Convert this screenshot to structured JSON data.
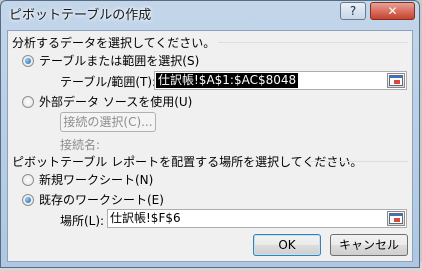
{
  "window": {
    "title": "ピボットテーブルの作成",
    "help_label": "?",
    "close_label": "✕"
  },
  "source_section": {
    "heading": "分析するデータを選択してください。",
    "option_table": {
      "label": "テーブルまたは範囲を選択(S)",
      "checked": true
    },
    "table_range": {
      "label": "テーブル/範囲(T):",
      "value": "仕訳帳!$A$1:$AC$8048"
    },
    "option_external": {
      "label": "外部データ ソースを使用(U)",
      "checked": false
    },
    "choose_connection_label": "接続の選択(C)...",
    "connection_name_label": "接続名:"
  },
  "location_section": {
    "heading": "ピボットテーブル レポートを配置する場所を選択してください。",
    "option_new": {
      "label": "新規ワークシート(N)",
      "checked": false
    },
    "option_existing": {
      "label": "既存のワークシート(E)",
      "checked": true
    },
    "location": {
      "label": "場所(L):",
      "value": "仕訳帳!$F$6"
    }
  },
  "buttons": {
    "ok": "OK",
    "cancel": "キャンセル"
  },
  "icons": {
    "collapse_dialog": "collapse-dialog-icon"
  }
}
